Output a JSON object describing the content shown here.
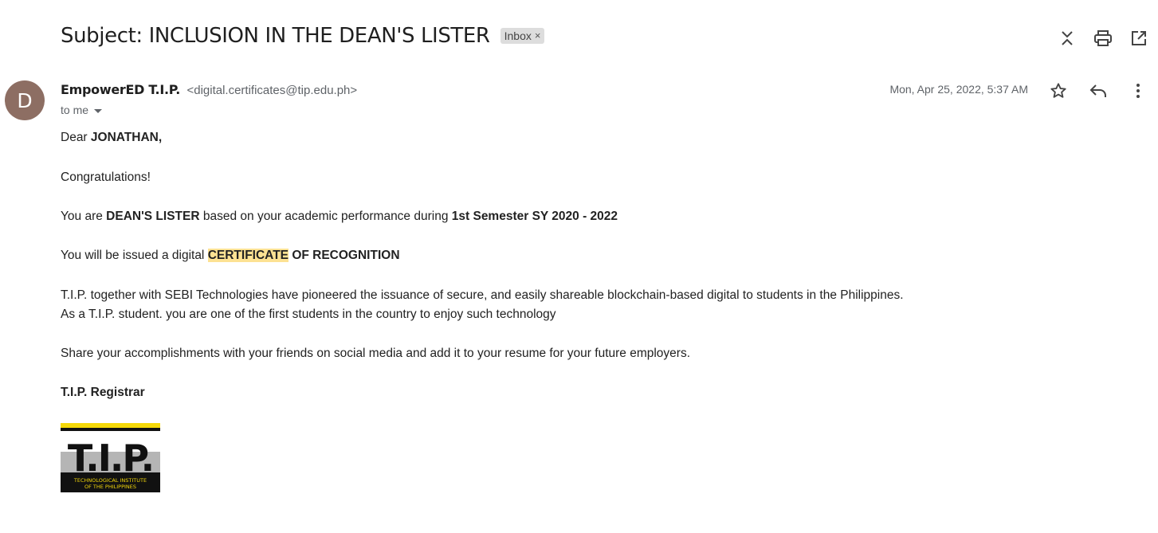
{
  "subject": {
    "title": "Subject: INCLUSION IN THE DEAN'S LISTER",
    "label": "Inbox",
    "label_remove": "×"
  },
  "toolbar": {
    "icons": [
      "collapse-all-icon",
      "print-icon",
      "open-in-new-window-icon"
    ]
  },
  "sender": {
    "avatar_letter": "D",
    "avatar_color": "#8d6e63",
    "name": "EmpowerED T.I.P.",
    "email": "<digital.certificates@tip.edu.ph>",
    "recipient": "to me",
    "date": "Mon, Apr 25, 2022, 5:37 AM"
  },
  "message_actions": {
    "icons": [
      "star-icon",
      "reply-icon",
      "more-vert-icon"
    ]
  },
  "body": {
    "greeting_prefix": "Dear ",
    "greeting_name": "JONATHAN,",
    "congrats": "Congratulations!",
    "line3_a": "You are ",
    "line3_b": "DEAN'S LISTER",
    "line3_c": " based on your academic performance during ",
    "line3_d": "1st Semester SY 2020 - 2022",
    "line4_a": "You will be issued a digital ",
    "line4_b": "CERTIFICATE",
    "line4_c": " OF RECOGNITION",
    "line5": "T.I.P. together with SEBI Technologies have pioneered the issuance of secure, and easily shareable blockchain-based digital to students in the Philippines.",
    "line6": "As a T.I.P. student. you are one of the first students in the country to enjoy such technology",
    "line7": "Share your accomplishments with your friends on social media and add it to your resume for your future employers.",
    "signature": "T.I.P. Registrar",
    "highlight_color": "#fde293"
  },
  "logo": {
    "text": "T.I.P.",
    "subtext_line1": "TECHNOLOGICAL INSTITUTE",
    "subtext_line2": "OF THE PHILIPPINES",
    "colors": {
      "black": "#111111",
      "yellow": "#f5d90a",
      "gray": "#b5b5b5"
    }
  }
}
